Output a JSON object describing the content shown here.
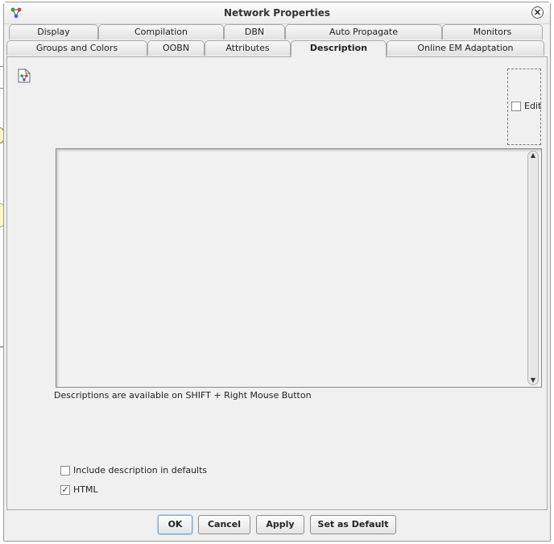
{
  "window": {
    "title": "Network Properties"
  },
  "tabs_row1": [
    "Display",
    "Compilation",
    "DBN",
    "Auto Propagate",
    "Monitors"
  ],
  "tabs_row2": [
    "Groups and Colors",
    "OOBN",
    "Attributes",
    "Description",
    "Online EM Adaptation"
  ],
  "active_tab": "Description",
  "description": {
    "edit_label": "Edit",
    "edit_checked": false,
    "text": "",
    "hint": "Descriptions are available on SHIFT + Right Mouse Button",
    "include_label": "Include description in defaults",
    "include_checked": false,
    "html_label": "HTML",
    "html_checked": true
  },
  "buttons": {
    "ok": "OK",
    "cancel": "Cancel",
    "apply": "Apply",
    "set_default": "Set as Default"
  },
  "icons": {
    "title": "network-icon",
    "doc": "document-network-icon",
    "close": "close-icon"
  }
}
